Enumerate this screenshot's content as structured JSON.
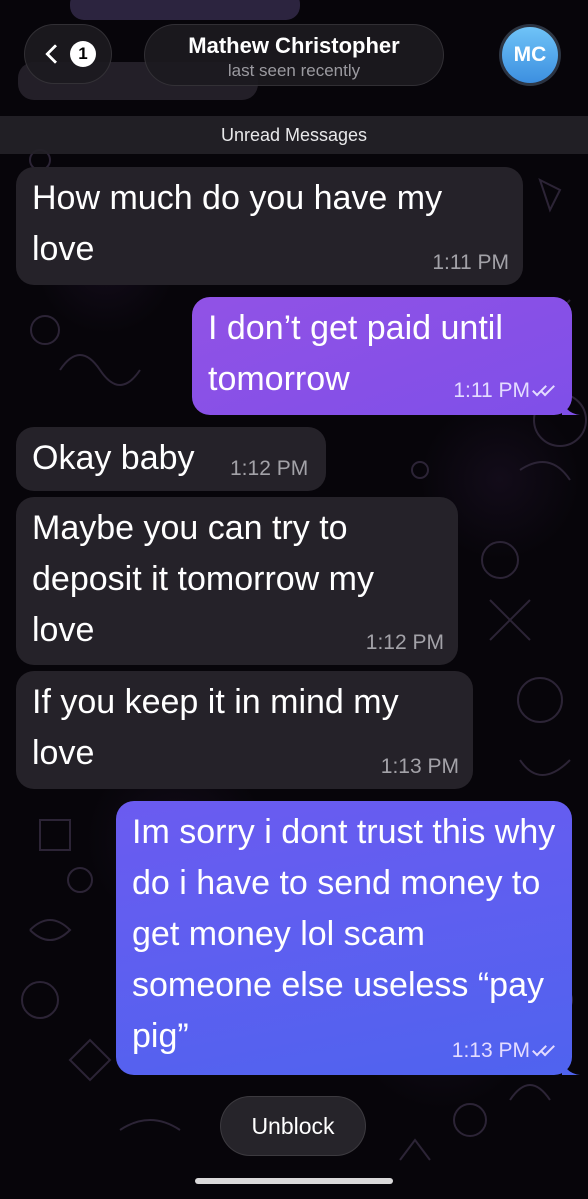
{
  "header": {
    "back_badge": "1",
    "contact_name": "Mathew Christopher",
    "contact_status": "last seen recently",
    "avatar_initials": "MC"
  },
  "unread_label": "Unread Messages",
  "messages": [
    {
      "direction": "incoming",
      "text": "How much do you have my love",
      "time": "1:11 PM"
    },
    {
      "direction": "outgoing",
      "text": "I don’t get paid until tomorrow",
      "time": "1:11 PM",
      "read": true
    },
    {
      "direction": "incoming",
      "text": "Okay baby",
      "time": "1:12 PM"
    },
    {
      "direction": "incoming",
      "text": "Maybe you can try to deposit it tomorrow my love",
      "time": "1:12 PM"
    },
    {
      "direction": "incoming",
      "text": "If you keep it in mind my love",
      "time": "1:13 PM"
    },
    {
      "direction": "outgoing",
      "text": "Im sorry i dont trust this why do i have to send money to get money lol scam someone else useless “pay pig”",
      "time": "1:13 PM",
      "read": true
    }
  ],
  "footer": {
    "unblock_label": "Unblock"
  },
  "colors": {
    "background": "#07050a",
    "incoming_bubble": "#252229",
    "outgoing_bubble_purple": "#8650e7",
    "outgoing_bubble_blue": "#5a60ef",
    "avatar": "#4fa8ee"
  }
}
